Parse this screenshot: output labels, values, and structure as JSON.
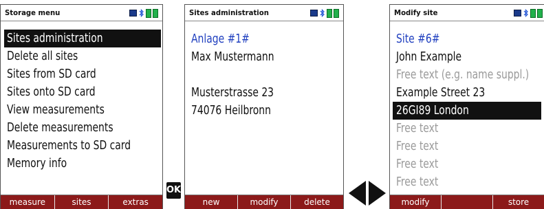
{
  "screens": [
    {
      "title": "Storage menu",
      "menu": [
        "Sites administration",
        "Delete all sites",
        "Sites from SD card",
        "Sites onto SD card",
        "View measurements",
        "Delete measurements",
        "Measurements to SD card",
        "Memory info"
      ],
      "selected_index": 0,
      "softkeys": [
        "measure",
        "sites",
        "extras"
      ]
    },
    {
      "title": "Sites administration",
      "lines": [
        "Anlage #1#",
        "Max Mustermann",
        "",
        "Musterstrasse 23",
        "74076 Heilbronn"
      ],
      "softkeys": [
        "new",
        "modify",
        "delete"
      ]
    },
    {
      "title": "Modify site",
      "lines": [
        "Site #6#",
        "John Example",
        "Free text (e.g. name suppl.)",
        "Example Street 23",
        "26GI89 London",
        "Free text",
        "Free text",
        "Free text",
        "Free text"
      ],
      "selected_index": 4,
      "softkeys": [
        "modify",
        "",
        "store"
      ]
    }
  ],
  "ok_key": "OK",
  "icons": {
    "status_block": "status-block-icon",
    "bluetooth": "bluetooth-icon",
    "battery": "battery-icon",
    "navigation": "left-right-arrows-icon"
  },
  "colors": {
    "softkey_bg": "#8c1a1a",
    "highlight_bg": "#111111",
    "title_blue": "#1f3fbf",
    "placeholder_grey": "#9a9a9a",
    "battery_green": "#22b14c"
  }
}
